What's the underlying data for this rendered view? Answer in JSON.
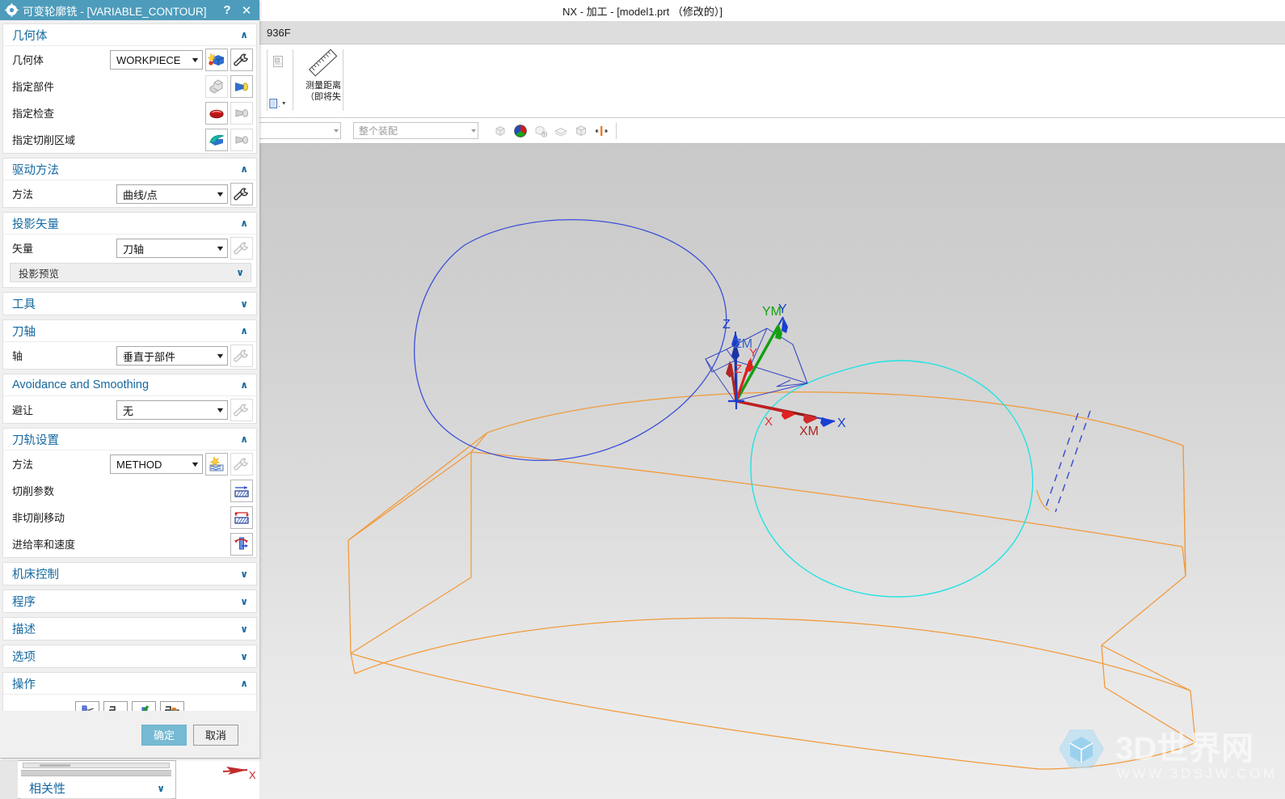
{
  "nx": {
    "title": "NX - 加工 - [model1.prt  （修改的）]",
    "ribbon_tab_fragment": "936F",
    "ribbon": {
      "measure_label_line1": "测量距离",
      "measure_label_line2": "（即将失",
      "small_dropdown": "▾"
    },
    "toolbar": {
      "combo1_value": "",
      "combo2_placeholder": "整个装配",
      "icons": [
        "render-style-icon",
        "color-wheel-icon",
        "show-hide-icon",
        "layer-icon",
        "box-wireframe-icon",
        "clip-section-icon"
      ]
    }
  },
  "behind_panel": {
    "section_label": "相关性"
  },
  "dialog": {
    "title": "可变轮廓铣 - [VARIABLE_CONTOUR]",
    "title_icons": {
      "gear": "gear-icon",
      "help": "?",
      "close": "✕"
    },
    "sections": [
      {
        "id": "geometry",
        "title": "几何体",
        "expanded": true,
        "rows": [
          {
            "label": "几何体",
            "control": "combo",
            "value": "WORKPIECE",
            "buttons": [
              "new-geometry-icon",
              "edit-wrench-icon"
            ]
          },
          {
            "label": "指定部件",
            "control": "none",
            "value": "",
            "buttons": [
              "part-geometry-icon",
              "select-part-icon"
            ]
          },
          {
            "label": "指定检查",
            "control": "none",
            "value": "",
            "buttons": [
              "check-geometry-icon",
              "select-check-icon"
            ]
          },
          {
            "label": "指定切削区域",
            "control": "none",
            "value": "",
            "buttons": [
              "cut-area-icon",
              "select-cut-area-icon"
            ]
          }
        ]
      },
      {
        "id": "drive-method",
        "title": "驱动方法",
        "expanded": true,
        "rows": [
          {
            "label": "方法",
            "control": "combo",
            "value": "曲线/点",
            "buttons": [
              "edit-wrench-icon"
            ]
          }
        ]
      },
      {
        "id": "projection-vector",
        "title": "投影矢量",
        "expanded": true,
        "rows": [
          {
            "label": "矢量",
            "control": "combo",
            "value": "刀轴",
            "buttons": [
              "edit-wrench-icon-disabled"
            ]
          }
        ],
        "subbar": "投影预览"
      },
      {
        "id": "tool",
        "title": "工具",
        "expanded": false,
        "rows": []
      },
      {
        "id": "tool-axis",
        "title": "刀轴",
        "expanded": true,
        "rows": [
          {
            "label": "轴",
            "control": "combo",
            "value": "垂直于部件",
            "buttons": [
              "edit-wrench-icon-disabled"
            ]
          }
        ]
      },
      {
        "id": "avoidance-smoothing",
        "title": "Avoidance and Smoothing",
        "expanded": true,
        "rows": [
          {
            "label": "避让",
            "control": "combo",
            "value": "无",
            "buttons": [
              "edit-wrench-icon-disabled"
            ]
          }
        ]
      },
      {
        "id": "path-settings",
        "title": "刀轨设置",
        "expanded": true,
        "rows": [
          {
            "label": "方法",
            "control": "combo",
            "value": "METHOD",
            "buttons": [
              "new-method-icon",
              "edit-wrench-icon-disabled"
            ]
          },
          {
            "label": "切削参数",
            "control": "none",
            "value": "",
            "buttons": [
              "cutting-parameters-icon"
            ]
          },
          {
            "label": "非切削移动",
            "control": "none",
            "value": "",
            "buttons": [
              "non-cutting-moves-icon"
            ]
          },
          {
            "label": "进给率和速度",
            "control": "none",
            "value": "",
            "buttons": [
              "feeds-speeds-icon"
            ]
          }
        ]
      },
      {
        "id": "machine-control",
        "title": "机床控制",
        "expanded": false,
        "rows": []
      },
      {
        "id": "program",
        "title": "程序",
        "expanded": false,
        "rows": []
      },
      {
        "id": "description",
        "title": "描述",
        "expanded": false,
        "rows": []
      },
      {
        "id": "options",
        "title": "选项",
        "expanded": false,
        "rows": []
      },
      {
        "id": "actions",
        "title": "操作",
        "expanded": true,
        "rows": [],
        "action_icons": [
          "generate-icon",
          "replay-icon",
          "verify-icon",
          "list-icon"
        ]
      }
    ],
    "footer": {
      "ok": "确定",
      "cancel": "取消"
    }
  },
  "viewport": {
    "csys_labels": {
      "wcs": {
        "x": "XM",
        "y": "YM",
        "z": "ZM"
      },
      "abs": {
        "x": "X",
        "y": "Y",
        "z": "Z"
      },
      "mcs": {
        "x": "X",
        "y": "Y",
        "z": "Z"
      }
    },
    "bottom_cue_label": "X",
    "watermark": {
      "title": "3D世界网",
      "url": "WWW.3DSJW.COM"
    },
    "colors": {
      "body_edges": "#f29938",
      "curve_blue": "#3b4fd8",
      "curve_cyan": "#22e2e2",
      "axis_x": "#ee1111",
      "axis_y": "#0aa80a",
      "axis_z": "#1a3fd0",
      "wcs_color": "#1a3fd0"
    }
  }
}
